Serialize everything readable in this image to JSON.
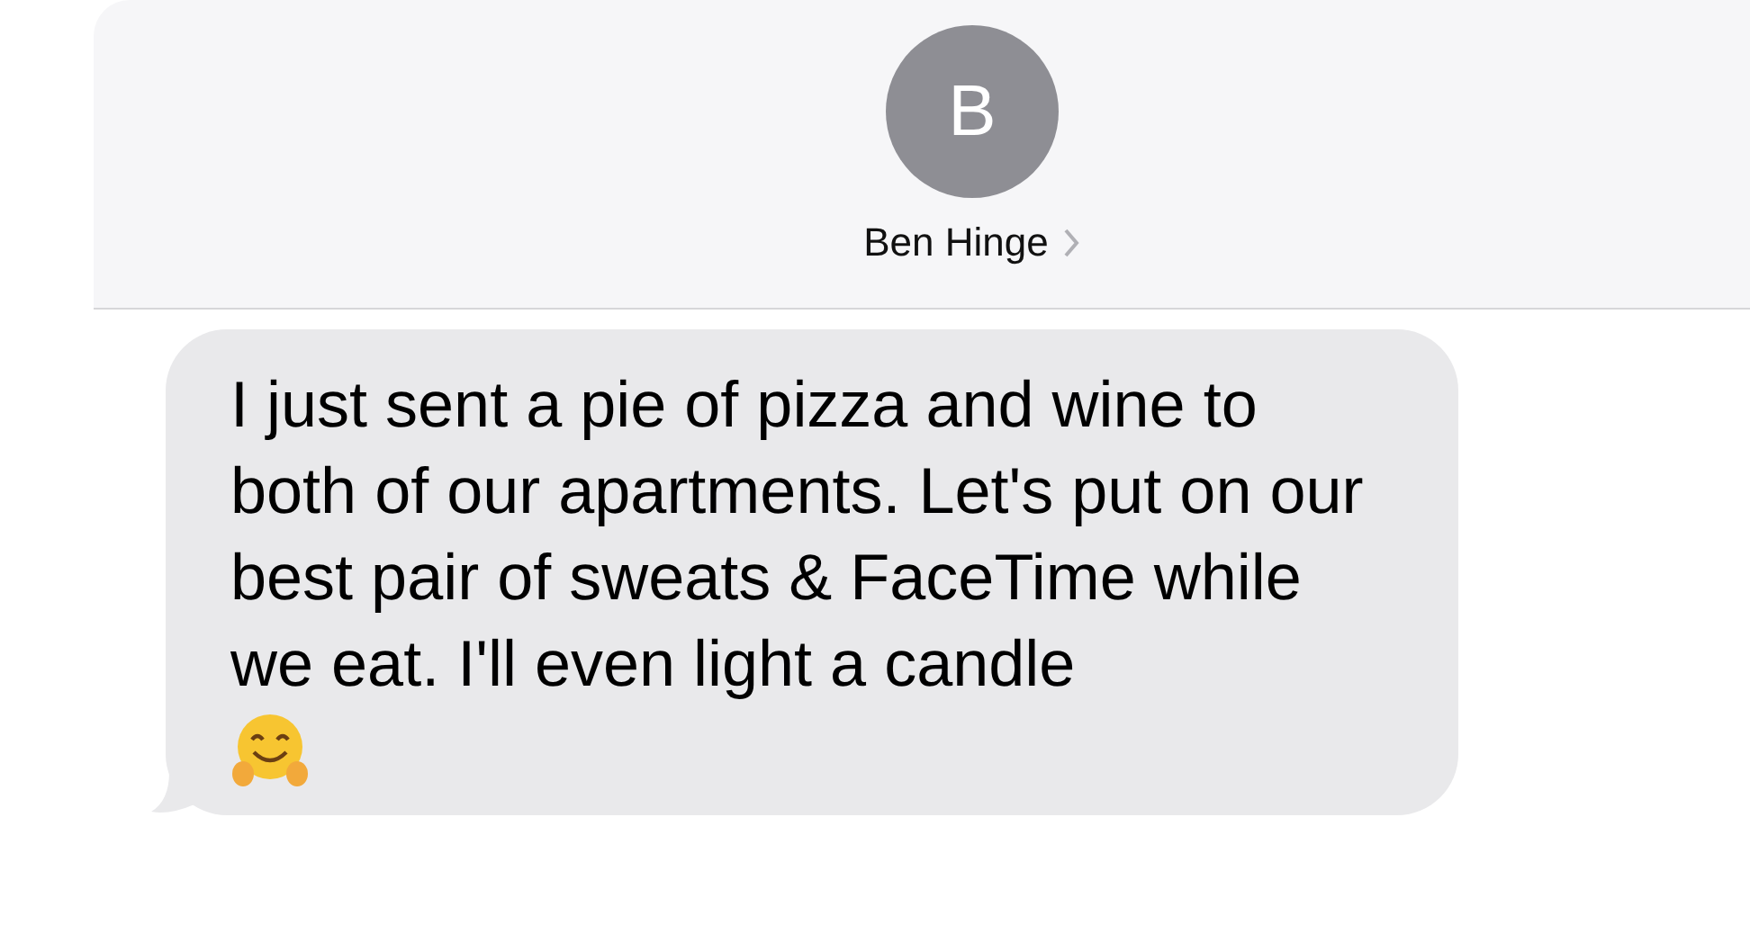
{
  "contact": {
    "initial": "B",
    "name": "Ben Hinge"
  },
  "messages": [
    {
      "text": "I just sent a pie of pizza and wine to both of our apartments. Let's put on our best pair of sweats & FaceTime while we eat. I'll even light a candle",
      "incoming": true
    }
  ]
}
